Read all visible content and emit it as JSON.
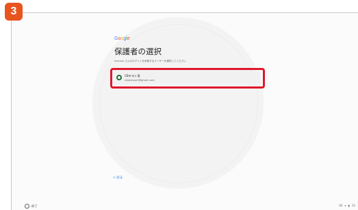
{
  "step_badge": "3",
  "logo": {
    "letters": [
      {
        "char": "G",
        "color": "#4285F4"
      },
      {
        "char": "o",
        "color": "#EA4335"
      },
      {
        "char": "o",
        "color": "#FBBC05"
      },
      {
        "char": "g",
        "color": "#4285F4"
      },
      {
        "char": "l",
        "color": "#34A853"
      },
      {
        "char": "e",
        "color": "#EA4335"
      }
    ]
  },
  "page": {
    "title": "保護者の選択",
    "subtitle": "hoshino さんのログインを承認するユーザーを選択してください"
  },
  "account": {
    "name": "CBテスト用",
    "email": "cbtestuser@gmail.com",
    "highlight_color": "#e0162b"
  },
  "back_label": "< 戻る",
  "shelf": {
    "left_icon": "settings-icon",
    "left_label": "終了",
    "right_items": [
      "US",
      "▾",
      "▮",
      "11:"
    ]
  }
}
